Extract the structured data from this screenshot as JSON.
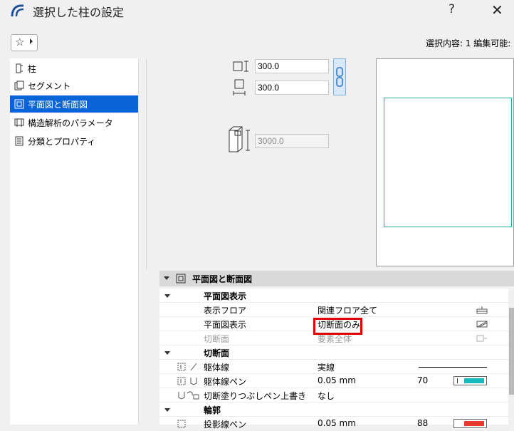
{
  "window": {
    "title": "選択した柱の設定",
    "help_glyph": "?",
    "close_glyph": "✕"
  },
  "favorites": {
    "star_glyph": "☆"
  },
  "selection_info": "選択内容: 1 編集可能:",
  "sidebar": {
    "items": [
      {
        "label": "柱",
        "icon": "column-icon"
      },
      {
        "label": "セグメント",
        "icon": "segment-icon"
      },
      {
        "label": "平面図と断面図",
        "icon": "plan-section-icon",
        "selected": true
      },
      {
        "label": "構造解析のパラメータ",
        "icon": "structural-analysis-icon"
      },
      {
        "label": "分類とプロパティ",
        "icon": "classification-icon"
      }
    ]
  },
  "geometry": {
    "width_value": "300.0",
    "depth_value": "300.0",
    "height_value": "3000.0"
  },
  "section": {
    "title": "平面図と断面図"
  },
  "rows": [
    {
      "type": "group",
      "label": "平面図表示"
    },
    {
      "type": "prop",
      "label": "表示フロア",
      "value": "関連フロア全て",
      "icon": "floor-icon"
    },
    {
      "type": "prop",
      "label": "平面図表示",
      "value": "切断面のみ",
      "icon": "plan-display-icon"
    },
    {
      "type": "prop",
      "label": "切断面",
      "value": "要素全体",
      "disabled": true,
      "icon": "cut-plane-icon"
    },
    {
      "type": "group",
      "label": "切断面"
    },
    {
      "type": "prop",
      "label": "躯体線",
      "value": "実線",
      "icon": "line-type-icon"
    },
    {
      "type": "prop",
      "label": "躯体線ペン",
      "value": "0.05 mm",
      "pen": "70",
      "swatch": "#17b8c0",
      "icon": "pen-icon"
    },
    {
      "type": "prop",
      "label": "切断塗りつぶしペン上書き",
      "value": "なし",
      "icon": "fill-override-icon"
    },
    {
      "type": "group",
      "label": "輪郭"
    },
    {
      "type": "prop",
      "label": "投影線ペン",
      "value": "0.05 mm",
      "pen": "88",
      "swatch": "#e83a2a",
      "icon": "pen-icon"
    }
  ]
}
